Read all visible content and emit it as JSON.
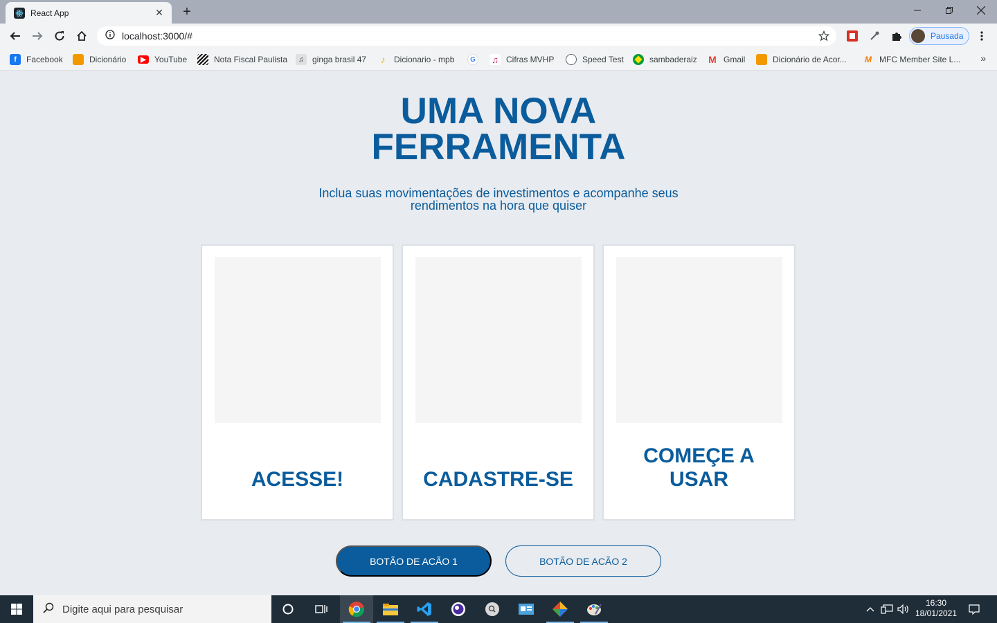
{
  "browser": {
    "tab_title": "React App",
    "url": "localhost:3000/#",
    "profile_label": "Pausada"
  },
  "bookmarks": [
    {
      "label": "Facebook",
      "icon": "facebook-icon"
    },
    {
      "label": "Dicionário",
      "icon": "dictionary-icon"
    },
    {
      "label": "YouTube",
      "icon": "youtube-icon"
    },
    {
      "label": "Nota Fiscal Paulista",
      "icon": "flag-icon"
    },
    {
      "label": "ginga brasil 47",
      "icon": "music-sheet-icon"
    },
    {
      "label": "Dicionario - mpb",
      "icon": "music-note-icon"
    },
    {
      "label": "",
      "icon": "google-icon"
    },
    {
      "label": "Cifras MVHP",
      "icon": "music-app-icon"
    },
    {
      "label": "Speed Test",
      "icon": "speedometer-icon"
    },
    {
      "label": "sambaderaiz",
      "icon": "brazil-flag-icon"
    },
    {
      "label": "Gmail",
      "icon": "gmail-icon"
    },
    {
      "label": "Dicionário de Acor...",
      "icon": "dictionary-icon"
    },
    {
      "label": "MFC Member Site L...",
      "icon": "mfc-icon"
    }
  ],
  "hero": {
    "title_line1": "UMA NOVA",
    "title_line2": "FERRAMENTA",
    "subtitle_line1": "Inclua suas movimentações de investimentos e acompanhe seus",
    "subtitle_line2": "rendimentos na hora que quiser"
  },
  "cards": [
    {
      "line1": "ACESSE!",
      "line2": ""
    },
    {
      "line1": "CADASTRE-SE",
      "line2": ""
    },
    {
      "line1": "COMEÇE A",
      "line2": "USAR"
    }
  ],
  "actions": {
    "primary_label": "BOTÃO DE ACÃO 1",
    "secondary_label": "BOTÃO DE ACÃO 2"
  },
  "taskbar": {
    "search_placeholder": "Digite aqui para pesquisar",
    "time": "16:30",
    "date": "18/01/2021"
  },
  "colors": {
    "brand_blue": "#0a5c9c",
    "page_bg": "#e8ebef",
    "card_bg": "#ffffff",
    "placeholder_bg": "#f5f5f5"
  }
}
